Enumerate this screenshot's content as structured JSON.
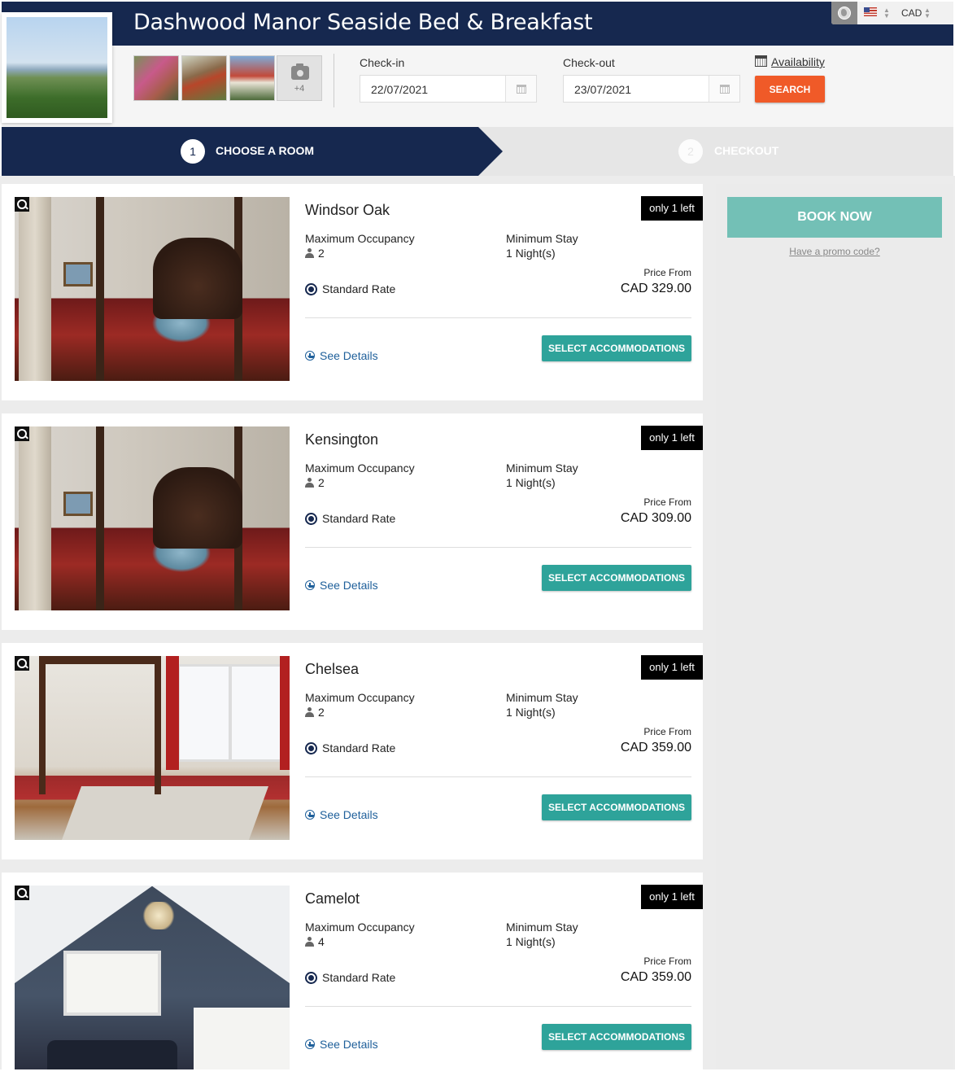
{
  "header": {
    "hotel_name": "Dashwood Manor Seaside Bed & Breakfast",
    "currency": "CAD",
    "more_photos": "+4"
  },
  "search": {
    "checkin_label": "Check-in",
    "checkin_value": "22/07/2021",
    "checkout_label": "Check-out",
    "checkout_value": "23/07/2021",
    "availability_label": "Availability",
    "search_label": "SEARCH"
  },
  "steps": [
    {
      "number": "1",
      "label": "CHOOSE A ROOM",
      "active": true
    },
    {
      "number": "2",
      "label": "CHECKOUT",
      "active": false
    }
  ],
  "labels": {
    "max_occupancy": "Maximum Occupancy",
    "min_stay": "Minimum Stay",
    "price_from": "Price From",
    "standard_rate": "Standard Rate",
    "see_details": "See Details",
    "select": "SELECT ACCOMMODATIONS"
  },
  "rooms": [
    {
      "name": "Windsor Oak",
      "availability": "only 1 left",
      "occupancy": "2",
      "min_stay": "1 Night(s)",
      "price": "CAD 329.00"
    },
    {
      "name": "Kensington",
      "availability": "only 1 left",
      "occupancy": "2",
      "min_stay": "1 Night(s)",
      "price": "CAD 309.00"
    },
    {
      "name": "Chelsea",
      "availability": "only 1 left",
      "occupancy": "2",
      "min_stay": "1 Night(s)",
      "price": "CAD 359.00"
    },
    {
      "name": "Camelot",
      "availability": "only 1 left",
      "occupancy": "4",
      "min_stay": "1 Night(s)",
      "price": "CAD 359.00"
    }
  ],
  "sidebar": {
    "book_now": "BOOK NOW",
    "promo": "Have a promo code?"
  },
  "colors": {
    "navy": "#16284f",
    "search_orange": "#f05a28",
    "teal": "#2ea39a",
    "book_now_teal": "#73c0b6"
  }
}
